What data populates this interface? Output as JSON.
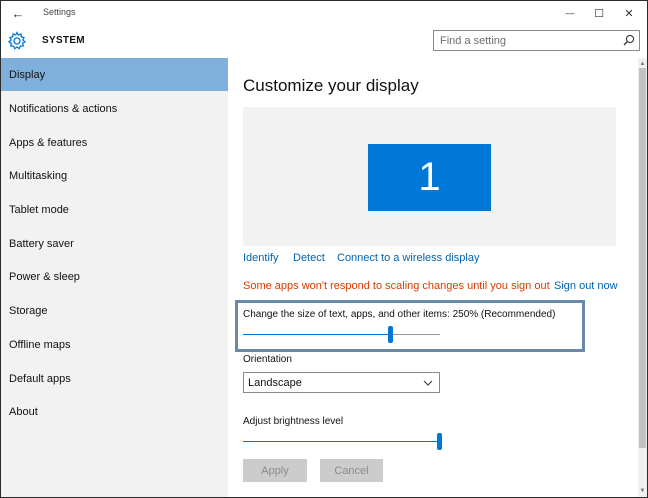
{
  "window": {
    "title": "Settings",
    "back_glyph": "←",
    "minimize_glyph": "—",
    "maximize_glyph": "☐",
    "close_glyph": "✕"
  },
  "header": {
    "section_title": "SYSTEM",
    "section_icon": "gear-icon",
    "search_placeholder": "Find a setting",
    "search_icon": "search-icon"
  },
  "sidebar": {
    "items": [
      {
        "label": "Display",
        "active": true
      },
      {
        "label": "Notifications & actions",
        "active": false
      },
      {
        "label": "Apps & features",
        "active": false
      },
      {
        "label": "Multitasking",
        "active": false
      },
      {
        "label": "Tablet mode",
        "active": false
      },
      {
        "label": "Battery saver",
        "active": false
      },
      {
        "label": "Power & sleep",
        "active": false
      },
      {
        "label": "Storage",
        "active": false
      },
      {
        "label": "Offline maps",
        "active": false
      },
      {
        "label": "Default apps",
        "active": false
      },
      {
        "label": "About",
        "active": false
      }
    ]
  },
  "main": {
    "title": "Customize your display",
    "monitor_number": "1",
    "links": {
      "identify": "Identify",
      "detect": "Detect",
      "connect": "Connect to a wireless display",
      "sign_out": "Sign out now"
    },
    "warning": "Some apps won't respond to scaling changes until you sign out",
    "scaling": {
      "label": "Change the size of text, apps, and other items: 250% (Recommended)",
      "value_fraction": 0.75
    },
    "orientation": {
      "label": "Orientation",
      "selected": "Landscape"
    },
    "brightness": {
      "label": "Adjust brightness level",
      "value_fraction": 1.0
    },
    "buttons": {
      "apply": "Apply",
      "cancel": "Cancel"
    }
  },
  "colors": {
    "accent": "#0078d7",
    "nav_active": "#7fb0dc",
    "link": "#0063b1",
    "warning": "#d83b01",
    "highlight_border": "#6a89a8"
  }
}
